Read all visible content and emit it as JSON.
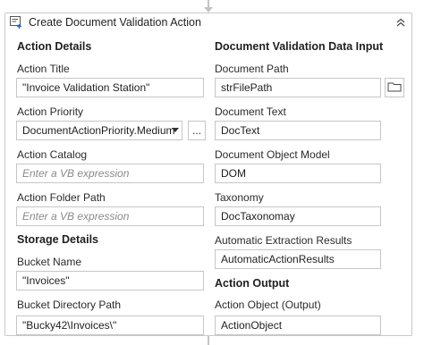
{
  "activity": {
    "title": "Create Document Validation Action",
    "icon": "validation-action-icon",
    "collapse_icon": "double-chevron-up-icon"
  },
  "left": {
    "action_details_heading": "Action Details",
    "action_title": {
      "label": "Action Title",
      "value": "\"Invoice Validation Station\""
    },
    "action_priority": {
      "label": "Action Priority",
      "value": "DocumentActionPriority.Medium",
      "more_label": "..."
    },
    "action_catalog": {
      "label": "Action Catalog",
      "placeholder": "Enter a VB expression"
    },
    "action_folder_path": {
      "label": "Action Folder Path",
      "placeholder": "Enter a VB expression"
    },
    "storage_details_heading": "Storage Details",
    "bucket_name": {
      "label": "Bucket Name",
      "value": "\"Invoices\""
    },
    "bucket_directory_path": {
      "label": "Bucket Directory Path",
      "value": "\"Bucky42\\Invoices\\\""
    }
  },
  "right": {
    "input_heading": "Document Validation Data Input",
    "document_path": {
      "label": "Document Path",
      "value": "strFilePath"
    },
    "document_text": {
      "label": "Document Text",
      "value": "DocText"
    },
    "document_object_model": {
      "label": "Document Object Model",
      "value": "DOM"
    },
    "taxonomy": {
      "label": "Taxonomy",
      "value": "DocTaxonomay"
    },
    "automatic_extraction_results": {
      "label": "Automatic Extraction Results",
      "value": "AutomaticActionResults"
    },
    "output_heading": "Action Output",
    "action_object": {
      "label": "Action Object (Output)",
      "value": "ActionObject"
    }
  }
}
